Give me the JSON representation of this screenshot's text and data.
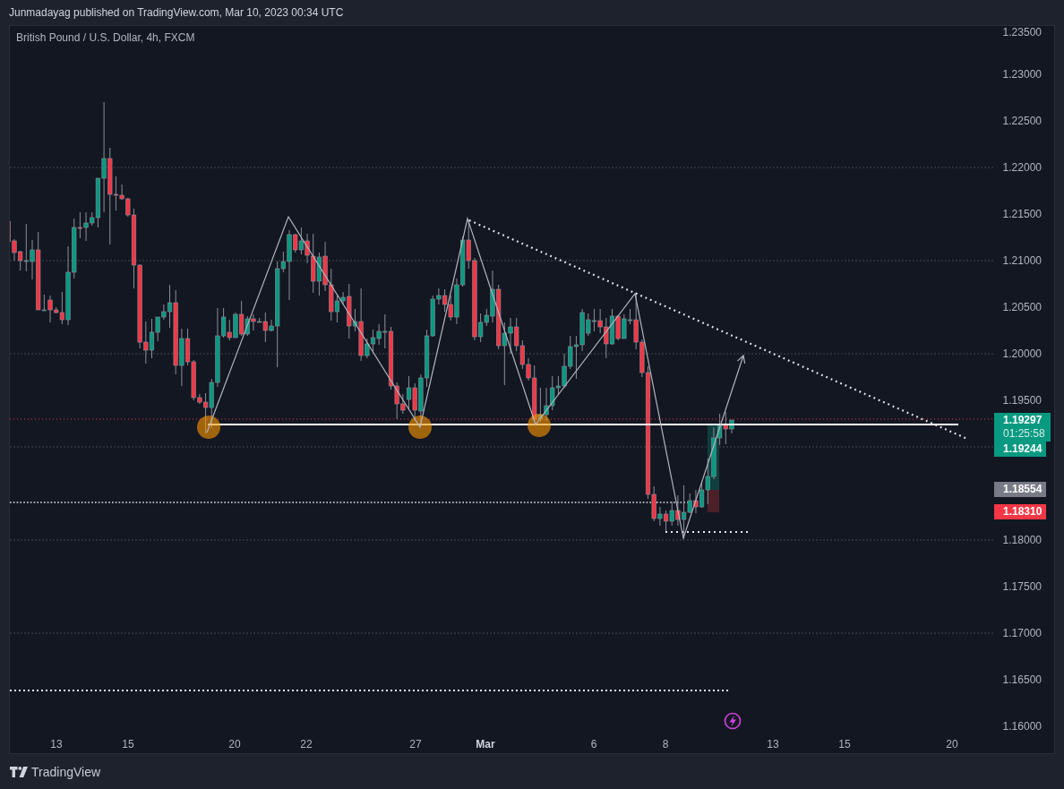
{
  "header": {
    "publication": "Junmadayag published on TradingView.com, Mar 10, 2023 00:34 UTC"
  },
  "chart": {
    "title": "British Pound / U.S. Dollar, 4h, FXCM",
    "price_axis": {
      "labels": [
        "1.23500",
        "1.23000",
        "1.22500",
        "1.22000",
        "1.21500",
        "1.21000",
        "1.20500",
        "1.20000",
        "1.19500",
        "1.18000",
        "1.17500",
        "1.17000",
        "1.16500",
        "1.16000"
      ]
    },
    "time_axis": {
      "labels": [
        {
          "text": "13",
          "kind": "day"
        },
        {
          "text": "15",
          "kind": "day"
        },
        {
          "text": "20",
          "kind": "day"
        },
        {
          "text": "22",
          "kind": "day"
        },
        {
          "text": "27",
          "kind": "day"
        },
        {
          "text": "Mar",
          "kind": "month"
        },
        {
          "text": "6",
          "kind": "day"
        },
        {
          "text": "8",
          "kind": "day"
        },
        {
          "text": "13",
          "kind": "day"
        },
        {
          "text": "15",
          "kind": "day"
        },
        {
          "text": "20",
          "kind": "day"
        }
      ]
    },
    "price_tags": [
      {
        "kind": "countdown",
        "price": "1.19297",
        "countdown": "01:25:58",
        "color": "#089981"
      },
      {
        "kind": "price",
        "price": "1.19244",
        "color": "#089981"
      },
      {
        "kind": "price",
        "price": "1.18554",
        "color": "#787b86"
      },
      {
        "kind": "price",
        "price": "1.18310",
        "color": "#f23645"
      }
    ]
  },
  "footer": {
    "brand": "TradingView"
  }
}
